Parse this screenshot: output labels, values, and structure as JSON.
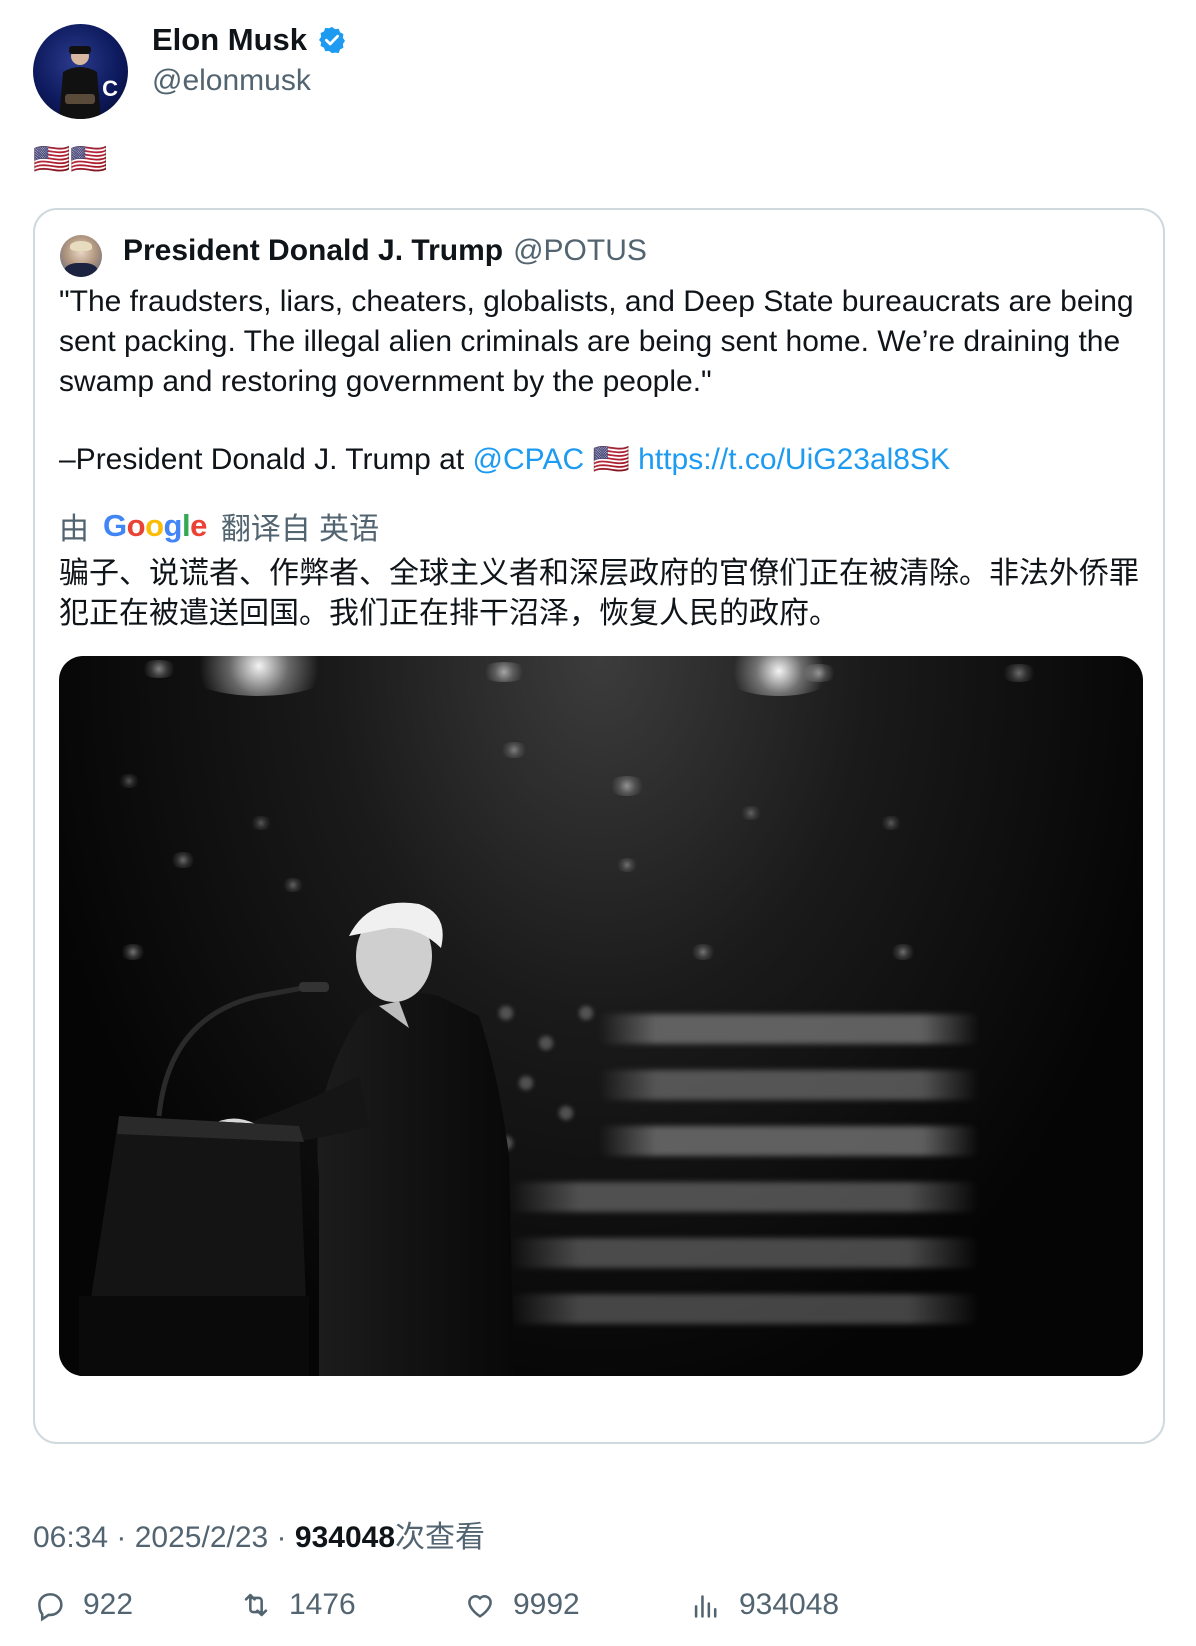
{
  "author": {
    "name": "Elon Musk",
    "handle": "@elonmusk",
    "avatar_mark": "C"
  },
  "tweet": {
    "text": "🇺🇸🇺🇸"
  },
  "quote": {
    "name": "President Donald J. Trump",
    "handle": "@POTUS",
    "body": "\"The fraudsters, liars, cheaters, globalists, and Deep State bureaucrats are being sent packing. The illegal alien criminals are being sent home. We’re draining the swamp and restoring government by the people.\"",
    "signature_prefix": "–President Donald J. Trump at ",
    "mention": "@CPAC",
    "flag": "🇺🇸",
    "link": "https://t.co/UiG23al8SK",
    "translate": {
      "by": "由",
      "provider": "Google",
      "from_label": "翻译自 英语"
    },
    "translated_text": "骗子、说谎者、作弊者、全球主义者和深层政府的官僚们正在被清除。非法外侨罪犯正在被遣送回国。我们正在排干沼泽，恢复人民的政府。"
  },
  "meta": {
    "time": "06:34",
    "date": "2025/2/23",
    "views": "934048",
    "views_label": "次查看"
  },
  "actions": {
    "replies": "922",
    "retweets": "1476",
    "likes": "9992",
    "views": "934048"
  },
  "colors": {
    "link": "#1d9bf0",
    "secondary": "#536471",
    "verified": "#1d9bf0"
  }
}
